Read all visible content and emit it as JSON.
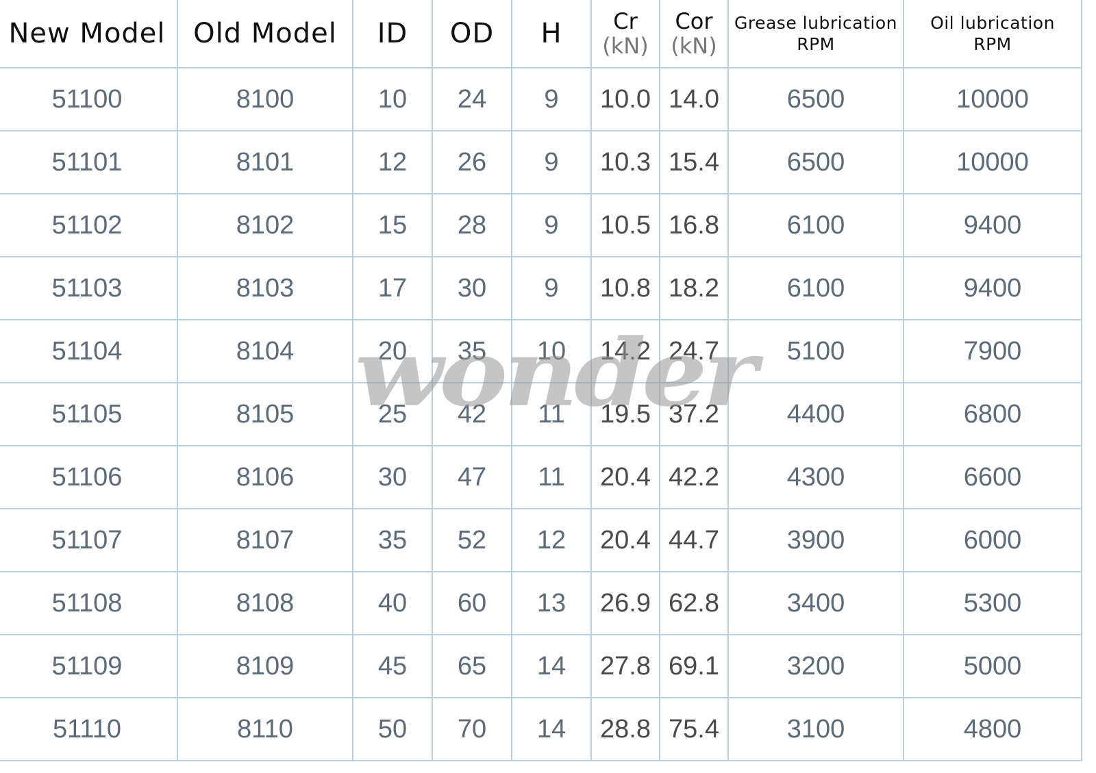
{
  "headers": {
    "new_model": "New Model",
    "old_model": "Old Model",
    "id": "ID",
    "od": "OD",
    "h": "H",
    "cr": "Cr",
    "cr_unit": "(kN)",
    "cor": "Cor",
    "cor_unit": "(kN)",
    "grease_line1": "Grease lubrication",
    "grease_line2": "RPM",
    "oil_line1": "Oil lubrication",
    "oil_line2": "RPM"
  },
  "rows": [
    {
      "new_model": "51100",
      "old_model": "8100",
      "id": "10",
      "od": "24",
      "h": "9",
      "cr": "10.0",
      "cor": "14.0",
      "grease_rpm": "6500",
      "oil_rpm": "10000"
    },
    {
      "new_model": "51101",
      "old_model": "8101",
      "id": "12",
      "od": "26",
      "h": "9",
      "cr": "10.3",
      "cor": "15.4",
      "grease_rpm": "6500",
      "oil_rpm": "10000"
    },
    {
      "new_model": "51102",
      "old_model": "8102",
      "id": "15",
      "od": "28",
      "h": "9",
      "cr": "10.5",
      "cor": "16.8",
      "grease_rpm": "6100",
      "oil_rpm": "9400"
    },
    {
      "new_model": "51103",
      "old_model": "8103",
      "id": "17",
      "od": "30",
      "h": "9",
      "cr": "10.8",
      "cor": "18.2",
      "grease_rpm": "6100",
      "oil_rpm": "9400"
    },
    {
      "new_model": "51104",
      "old_model": "8104",
      "id": "20",
      "od": "35",
      "h": "10",
      "cr": "14.2",
      "cor": "24.7",
      "grease_rpm": "5100",
      "oil_rpm": "7900"
    },
    {
      "new_model": "51105",
      "old_model": "8105",
      "id": "25",
      "od": "42",
      "h": "11",
      "cr": "19.5",
      "cor": "37.2",
      "grease_rpm": "4400",
      "oil_rpm": "6800"
    },
    {
      "new_model": "51106",
      "old_model": "8106",
      "id": "30",
      "od": "47",
      "h": "11",
      "cr": "20.4",
      "cor": "42.2",
      "grease_rpm": "4300",
      "oil_rpm": "6600"
    },
    {
      "new_model": "51107",
      "old_model": "8107",
      "id": "35",
      "od": "52",
      "h": "12",
      "cr": "20.4",
      "cor": "44.7",
      "grease_rpm": "3900",
      "oil_rpm": "6000"
    },
    {
      "new_model": "51108",
      "old_model": "8108",
      "id": "40",
      "od": "60",
      "h": "13",
      "cr": "26.9",
      "cor": "62.8",
      "grease_rpm": "3400",
      "oil_rpm": "5300"
    },
    {
      "new_model": "51109",
      "old_model": "8109",
      "id": "45",
      "od": "65",
      "h": "14",
      "cr": "27.8",
      "cor": "69.1",
      "grease_rpm": "3200",
      "oil_rpm": "5000"
    },
    {
      "new_model": "51110",
      "old_model": "8110",
      "id": "50",
      "od": "70",
      "h": "14",
      "cr": "28.8",
      "cor": "75.4",
      "grease_rpm": "3100",
      "oil_rpm": "4800"
    }
  ],
  "watermark": "wonder",
  "colors": {
    "grid_line": "#b7cfe0",
    "cell_text": "#5b6b7a",
    "header_text": "#111111"
  }
}
